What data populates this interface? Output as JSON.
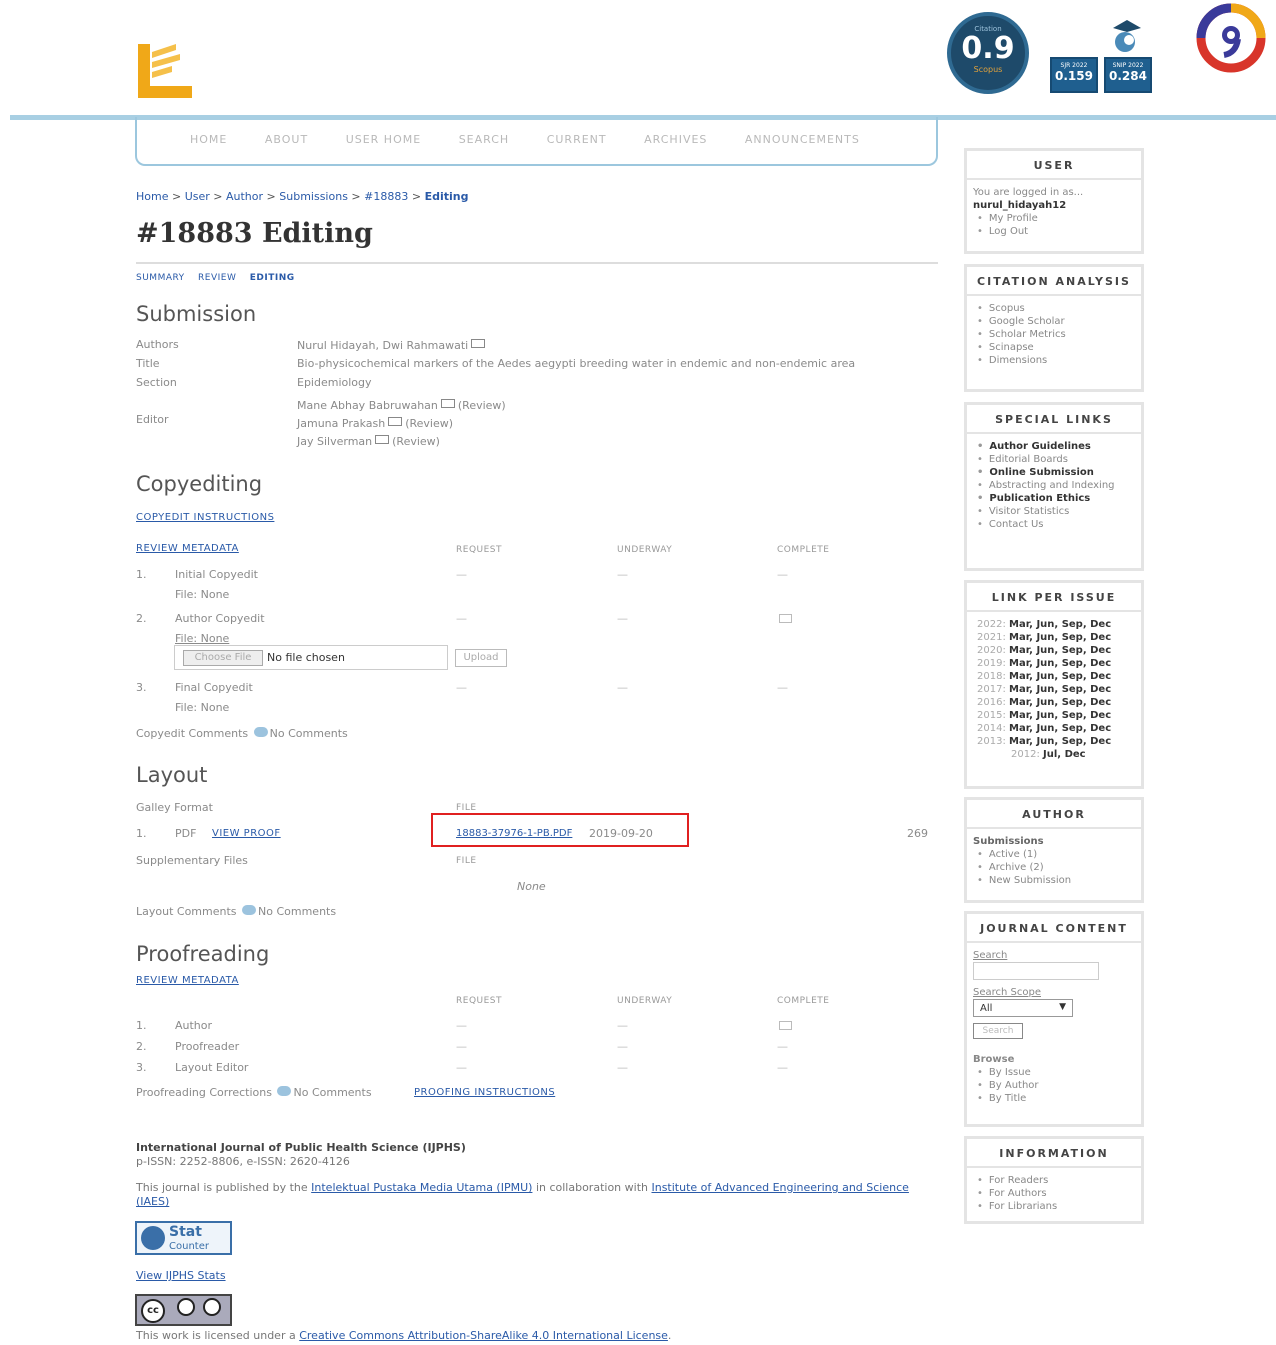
{
  "header": {
    "badge_top": "Citation",
    "badge_value": "0.9",
    "badge_sub": "Scopus",
    "sjr_label": "SJR 2022",
    "sjr_value": "0.159",
    "snip_label": "SNIP 2022",
    "snip_value": "0.284"
  },
  "nav": [
    "HOME",
    "ABOUT",
    "USER HOME",
    "SEARCH",
    "CURRENT",
    "ARCHIVES",
    "ANNOUNCEMENTS"
  ],
  "breadcrumb": [
    "Home",
    "User",
    "Author",
    "Submissions",
    "#18883",
    "Editing"
  ],
  "page_title": "#18883 Editing",
  "subtabs": [
    "SUMMARY",
    "REVIEW",
    "EDITING"
  ],
  "submission": {
    "heading": "Submission",
    "authors_label": "Authors",
    "authors": "Nurul Hidayah, Dwi Rahmawati",
    "title_label": "Title",
    "title": "Bio-physicochemical markers of the Aedes aegypti breeding water in endemic and non-endemic area",
    "section_label": "Section",
    "section": "Epidemiology",
    "editor_label": "Editor",
    "editors": [
      {
        "name": "Mane Abhay Babruwahan",
        "role": "(Review)"
      },
      {
        "name": "Jamuna Prakash",
        "role": "(Review)"
      },
      {
        "name": "Jay Silverman",
        "role": "(Review)"
      }
    ]
  },
  "copyediting": {
    "heading": "Copyediting",
    "instructions": "COPYEDIT INSTRUCTIONS",
    "review_metadata": "REVIEW METADATA",
    "col_request": "REQUEST",
    "col_underway": "UNDERWAY",
    "col_complete": "COMPLETE",
    "rows": [
      {
        "num": "1.",
        "name": "Initial Copyedit",
        "file": "File: None"
      },
      {
        "num": "2.",
        "name": "Author Copyedit",
        "file": "File: None"
      },
      {
        "num": "3.",
        "name": "Final Copyedit",
        "file": "File: None"
      }
    ],
    "dash": "—",
    "choose_file": "Choose File",
    "no_file": "No file chosen",
    "upload": "Upload",
    "comments_label": "Copyedit Comments",
    "no_comments": "No Comments"
  },
  "layout": {
    "heading": "Layout",
    "galley_label": "Galley Format",
    "file_col": "FILE",
    "row_num": "1.",
    "row_fmt": "PDF",
    "view_proof": "VIEW PROOF",
    "file_link": "18883-37976-1-PB.PDF",
    "file_date": "2019-09-20",
    "file_count": "269",
    "supp_label": "Supplementary Files",
    "supp_file_col": "FILE",
    "supp_none": "None",
    "comments_label": "Layout Comments",
    "no_comments": "No Comments"
  },
  "proofreading": {
    "heading": "Proofreading",
    "review_metadata": "REVIEW METADATA",
    "col_request": "REQUEST",
    "col_underway": "UNDERWAY",
    "col_complete": "COMPLETE",
    "rows": [
      {
        "num": "1.",
        "name": "Author"
      },
      {
        "num": "2.",
        "name": "Proofreader"
      },
      {
        "num": "3.",
        "name": "Layout Editor"
      }
    ],
    "dash": "—",
    "corrections_label": "Proofreading Corrections",
    "no_comments": "No Comments",
    "instructions": "PROOFING INSTRUCTIONS"
  },
  "footer": {
    "journal": "International Journal of Public Health Science (IJPHS)",
    "issn": "p-ISSN: 2252-8806, e-ISSN: 2620-4126",
    "pub_pre": "This journal is published by the",
    "publisher": "Intelektual Pustaka Media Utama (IPMU)",
    "pub_mid": "in collaboration with",
    "partner": "Institute of Advanced Engineering and Science (IAES)",
    "stat_top": "Stat",
    "stat_bottom": "Counter",
    "view_stats": "View IJPHS Stats",
    "license_pre": "This work is licensed under a",
    "license": "Creative Commons Attribution-ShareAlike 4.0 International License",
    "license_post": "."
  },
  "sidebar": {
    "user": {
      "title": "USER",
      "logged": "You are logged in as...",
      "username": "nurul_hidayah12",
      "links": [
        "My Profile",
        "Log Out"
      ]
    },
    "citation": {
      "title": "CITATION ANALYSIS",
      "links": [
        "Scopus",
        "Google Scholar",
        "Scholar Metrics",
        "Scinapse",
        "Dimensions"
      ]
    },
    "special": {
      "title": "SPECIAL LINKS",
      "links": [
        "Author Guidelines",
        "Editorial Boards",
        "Online Submission",
        "Abstracting and Indexing",
        "Publication Ethics",
        "Visitor Statistics",
        "Contact Us"
      ]
    },
    "issues": {
      "title": "LINK PER ISSUE",
      "rows": [
        {
          "year": "2022",
          "months": "Mar, Jun, Sep, Dec"
        },
        {
          "year": "2021",
          "months": "Mar, Jun, Sep, Dec"
        },
        {
          "year": "2020",
          "months": "Mar, Jun, Sep, Dec"
        },
        {
          "year": "2019",
          "months": "Mar, Jun, Sep, Dec"
        },
        {
          "year": "2018",
          "months": "Mar, Jun, Sep, Dec"
        },
        {
          "year": "2017",
          "months": "Mar, Jun, Sep, Dec"
        },
        {
          "year": "2016",
          "months": "Mar, Jun, Sep, Dec"
        },
        {
          "year": "2015",
          "months": "Mar, Jun, Sep, Dec"
        },
        {
          "year": "2014",
          "months": "Mar, Jun, Sep, Dec"
        },
        {
          "year": "2013",
          "months": "Mar, Jun, Sep, Dec"
        },
        {
          "year": "2012",
          "months": "Jul, Dec"
        }
      ]
    },
    "author": {
      "title": "AUTHOR",
      "sub": "Submissions",
      "links": [
        "Active (1)",
        "Archive (2)",
        "New Submission"
      ]
    },
    "journal": {
      "title": "JOURNAL CONTENT",
      "search_label": "Search",
      "scope_label": "Search Scope",
      "scope_value": "All",
      "search_btn": "Search",
      "browse": "Browse",
      "links": [
        "By Issue",
        "By Author",
        "By Title"
      ]
    },
    "info": {
      "title": "INFORMATION",
      "links": [
        "For Readers",
        "For Authors",
        "For Librarians"
      ]
    }
  }
}
